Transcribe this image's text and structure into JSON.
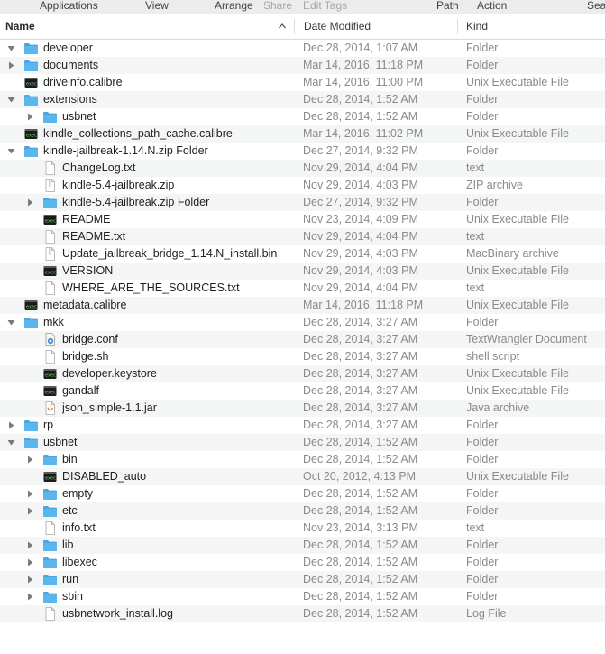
{
  "toolbar": {
    "labels": [
      {
        "text": "Applications",
        "dim": false
      },
      {
        "text": "View",
        "dim": false
      },
      {
        "text": "Arrange",
        "dim": false
      },
      {
        "text": "Share",
        "dim": true
      },
      {
        "text": "Edit Tags",
        "dim": true
      },
      {
        "text": "Path",
        "dim": false
      },
      {
        "text": "Action",
        "dim": false
      },
      {
        "text": "Sea",
        "dim": false
      }
    ]
  },
  "columns": {
    "name": "Name",
    "date": "Date Modified",
    "kind": "Kind"
  },
  "colors": {
    "folder": "#5ab6ed",
    "folder_tab": "#4aa6e0",
    "alt_row": "#f4f5f5",
    "secondary_text": "#8a8a8a"
  },
  "rows": [
    {
      "name": "developer",
      "date": "Dec 28, 2014, 1:07 AM",
      "kind": "Folder",
      "level": 0,
      "icon": "folder-icon",
      "disclosure": "expanded"
    },
    {
      "name": "documents",
      "date": "Mar 14, 2016, 11:18 PM",
      "kind": "Folder",
      "level": 0,
      "icon": "folder-icon",
      "disclosure": "collapsed"
    },
    {
      "name": "driveinfo.calibre",
      "date": "Mar 14, 2016, 11:00 PM",
      "kind": "Unix Executable File",
      "level": 0,
      "icon": "executable-icon",
      "disclosure": "none"
    },
    {
      "name": "extensions",
      "date": "Dec 28, 2014, 1:52 AM",
      "kind": "Folder",
      "level": 0,
      "icon": "folder-icon",
      "disclosure": "expanded"
    },
    {
      "name": "usbnet",
      "date": "Dec 28, 2014, 1:52 AM",
      "kind": "Folder",
      "level": 1,
      "icon": "folder-icon",
      "disclosure": "collapsed"
    },
    {
      "name": "kindle_collections_path_cache.calibre",
      "date": "Mar 14, 2016, 11:02 PM",
      "kind": "Unix Executable File",
      "level": 0,
      "icon": "executable-icon",
      "disclosure": "none"
    },
    {
      "name": "kindle-jailbreak-1.14.N.zip Folder",
      "date": "Dec 27, 2014, 9:32 PM",
      "kind": "Folder",
      "level": 0,
      "icon": "folder-icon",
      "disclosure": "expanded"
    },
    {
      "name": "ChangeLog.txt",
      "date": "Nov 29, 2014, 4:04 PM",
      "kind": "text",
      "level": 1,
      "icon": "text-file-icon",
      "disclosure": "none"
    },
    {
      "name": "kindle-5.4-jailbreak.zip",
      "date": "Nov 29, 2014, 4:03 PM",
      "kind": "ZIP archive",
      "level": 1,
      "icon": "zip-file-icon",
      "disclosure": "none"
    },
    {
      "name": "kindle-5.4-jailbreak.zip Folder",
      "date": "Dec 27, 2014, 9:32 PM",
      "kind": "Folder",
      "level": 1,
      "icon": "folder-icon",
      "disclosure": "collapsed"
    },
    {
      "name": "README",
      "date": "Nov 23, 2014, 4:09 PM",
      "kind": "Unix Executable File",
      "level": 1,
      "icon": "executable-icon",
      "disclosure": "none"
    },
    {
      "name": "README.txt",
      "date": "Nov 29, 2014, 4:04 PM",
      "kind": "text",
      "level": 1,
      "icon": "text-file-icon",
      "disclosure": "none"
    },
    {
      "name": "Update_jailbreak_bridge_1.14.N_install.bin",
      "date": "Nov 29, 2014, 4:03 PM",
      "kind": "MacBinary archive",
      "level": 1,
      "icon": "zip-file-icon",
      "disclosure": "none"
    },
    {
      "name": "VERSION",
      "date": "Nov 29, 2014, 4:03 PM",
      "kind": "Unix Executable File",
      "level": 1,
      "icon": "executable-icon",
      "disclosure": "none"
    },
    {
      "name": "WHERE_ARE_THE_SOURCES.txt",
      "date": "Nov 29, 2014, 4:04 PM",
      "kind": "text",
      "level": 1,
      "icon": "text-file-icon",
      "disclosure": "none"
    },
    {
      "name": "metadata.calibre",
      "date": "Mar 14, 2016, 11:18 PM",
      "kind": "Unix Executable File",
      "level": 0,
      "icon": "executable-icon",
      "disclosure": "none"
    },
    {
      "name": "mkk",
      "date": "Dec 28, 2014, 3:27 AM",
      "kind": "Folder",
      "level": 0,
      "icon": "folder-icon",
      "disclosure": "expanded"
    },
    {
      "name": "bridge.conf",
      "date": "Dec 28, 2014, 3:27 AM",
      "kind": "TextWrangler Document",
      "level": 1,
      "icon": "textwrangler-doc-icon",
      "disclosure": "none"
    },
    {
      "name": "bridge.sh",
      "date": "Dec 28, 2014, 3:27 AM",
      "kind": "shell script",
      "level": 1,
      "icon": "text-file-icon",
      "disclosure": "none"
    },
    {
      "name": "developer.keystore",
      "date": "Dec 28, 2014, 3:27 AM",
      "kind": "Unix Executable File",
      "level": 1,
      "icon": "executable-icon",
      "disclosure": "none"
    },
    {
      "name": "gandalf",
      "date": "Dec 28, 2014, 3:27 AM",
      "kind": "Unix Executable File",
      "level": 1,
      "icon": "executable-icon",
      "disclosure": "none"
    },
    {
      "name": "json_simple-1.1.jar",
      "date": "Dec 28, 2014, 3:27 AM",
      "kind": "Java archive",
      "level": 1,
      "icon": "jar-file-icon",
      "disclosure": "none"
    },
    {
      "name": "rp",
      "date": "Dec 28, 2014, 3:27 AM",
      "kind": "Folder",
      "level": 0,
      "icon": "folder-icon",
      "disclosure": "collapsed"
    },
    {
      "name": "usbnet",
      "date": "Dec 28, 2014, 1:52 AM",
      "kind": "Folder",
      "level": 0,
      "icon": "folder-icon",
      "disclosure": "expanded"
    },
    {
      "name": "bin",
      "date": "Dec 28, 2014, 1:52 AM",
      "kind": "Folder",
      "level": 1,
      "icon": "folder-icon",
      "disclosure": "collapsed"
    },
    {
      "name": "DISABLED_auto",
      "date": "Oct 20, 2012, 4:13 PM",
      "kind": "Unix Executable File",
      "level": 1,
      "icon": "executable-icon",
      "disclosure": "none"
    },
    {
      "name": "empty",
      "date": "Dec 28, 2014, 1:52 AM",
      "kind": "Folder",
      "level": 1,
      "icon": "folder-icon",
      "disclosure": "collapsed"
    },
    {
      "name": "etc",
      "date": "Dec 28, 2014, 1:52 AM",
      "kind": "Folder",
      "level": 1,
      "icon": "folder-icon",
      "disclosure": "collapsed"
    },
    {
      "name": "info.txt",
      "date": "Nov 23, 2014, 3:13 PM",
      "kind": "text",
      "level": 1,
      "icon": "text-file-icon",
      "disclosure": "none"
    },
    {
      "name": "lib",
      "date": "Dec 28, 2014, 1:52 AM",
      "kind": "Folder",
      "level": 1,
      "icon": "folder-icon",
      "disclosure": "collapsed"
    },
    {
      "name": "libexec",
      "date": "Dec 28, 2014, 1:52 AM",
      "kind": "Folder",
      "level": 1,
      "icon": "folder-icon",
      "disclosure": "collapsed"
    },
    {
      "name": "run",
      "date": "Dec 28, 2014, 1:52 AM",
      "kind": "Folder",
      "level": 1,
      "icon": "folder-icon",
      "disclosure": "collapsed"
    },
    {
      "name": "sbin",
      "date": "Dec 28, 2014, 1:52 AM",
      "kind": "Folder",
      "level": 1,
      "icon": "folder-icon",
      "disclosure": "collapsed"
    },
    {
      "name": "usbnetwork_install.log",
      "date": "Dec 28, 2014, 1:52 AM",
      "kind": "Log File",
      "level": 1,
      "icon": "text-file-icon",
      "disclosure": "none"
    }
  ]
}
